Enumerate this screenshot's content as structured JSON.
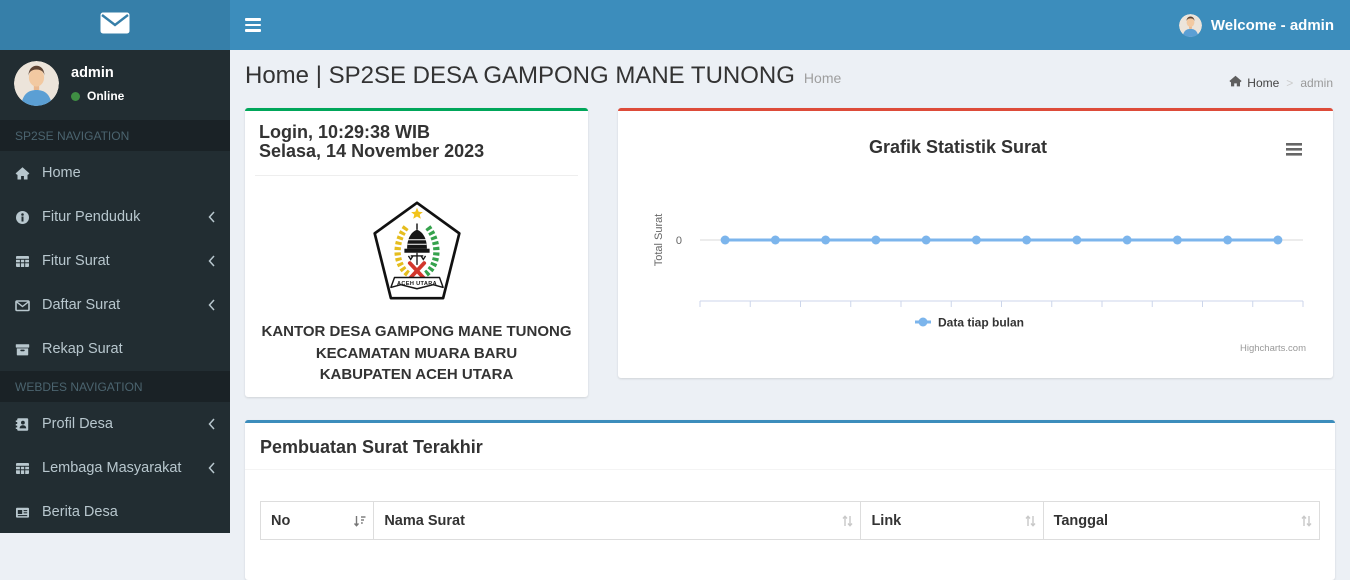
{
  "colors": {
    "navbar": "#3c8dbc",
    "brand_bg": "#367fa9",
    "sidebar_bg": "#222d32",
    "sidebar_header_bg": "#1a2226",
    "sidebar_text": "#b8c7ce",
    "content_bg": "#ecf0f5",
    "box_green_border": "#00a65a",
    "box_red_border": "#dd4b39",
    "box_blue_border": "#3c8dbc",
    "chart_line": "#7cb5ec",
    "online_dot": "#3f8e43"
  },
  "header": {
    "brand_icon": "envelope-icon",
    "toggle_icon": "hamburger-icon",
    "user_avatar_icon": "person-avatar-icon",
    "welcome_text": "Welcome - admin"
  },
  "sidebar": {
    "user": {
      "name": "admin",
      "status": "Online",
      "avatar_icon": "person-avatar-icon"
    },
    "sections": [
      {
        "label": "SP2SE NAVIGATION",
        "items": [
          {
            "label": "Home",
            "icon": "home-icon",
            "has_submenu": false
          },
          {
            "label": "Fitur Penduduk",
            "icon": "info-circle-icon",
            "has_submenu": true
          },
          {
            "label": "Fitur Surat",
            "icon": "table-icon",
            "has_submenu": true
          },
          {
            "label": "Daftar Surat",
            "icon": "envelope-icon",
            "has_submenu": true
          },
          {
            "label": "Rekap Surat",
            "icon": "archive-icon",
            "has_submenu": false
          }
        ]
      },
      {
        "label": "WEBDES NAVIGATION",
        "items": [
          {
            "label": "Profil Desa",
            "icon": "address-book-icon",
            "has_submenu": true
          },
          {
            "label": "Lembaga Masyarakat",
            "icon": "table-icon",
            "has_submenu": true
          },
          {
            "label": "Berita Desa",
            "icon": "newspaper-icon",
            "has_submenu": false
          }
        ]
      }
    ]
  },
  "content_header": {
    "title": "Home | SP2SE DESA GAMPONG MANE TUNONG",
    "subtitle": "Home",
    "breadcrumb": {
      "home_icon": "home-icon",
      "home_label": "Home",
      "separator": ">",
      "current": "admin"
    }
  },
  "login_box": {
    "time_line": "Login, 10:29:38 WIB",
    "date_line": "Selasa, 14 November 2023",
    "emblem_banner_text": "ACEH UTARA",
    "office_lines": [
      "KANTOR DESA GAMPONG MANE TUNONG",
      "KECAMATAN MUARA BARU",
      "KABUPATEN ACEH UTARA"
    ]
  },
  "chart_data": {
    "type": "line",
    "title": "Grafik Statistik Surat",
    "ylabel": "Total Surat",
    "xlabel": "",
    "series": [
      {
        "name": "Data tiap bulan",
        "color": "#7cb5ec",
        "values": [
          0,
          0,
          0,
          0,
          0,
          0,
          0,
          0,
          0,
          0,
          0,
          0
        ]
      }
    ],
    "x_categories_count": 12,
    "x_tick_labels": [],
    "y_ticks": [
      0
    ],
    "grid": "single-horizontal-line-at-zero",
    "legend_position": "bottom-center",
    "credit": "Highcharts.com",
    "export_menu_icon": "hamburger-icon"
  },
  "table_box": {
    "title": "Pembuatan Surat Terakhir",
    "columns": [
      {
        "label": "No",
        "sort_icon": "sort-asc-active-icon"
      },
      {
        "label": "Nama Surat",
        "sort_icon": "sort-both-icon"
      },
      {
        "label": "Link",
        "sort_icon": "sort-both-icon"
      },
      {
        "label": "Tanggal",
        "sort_icon": "sort-both-icon"
      }
    ],
    "rows": []
  }
}
